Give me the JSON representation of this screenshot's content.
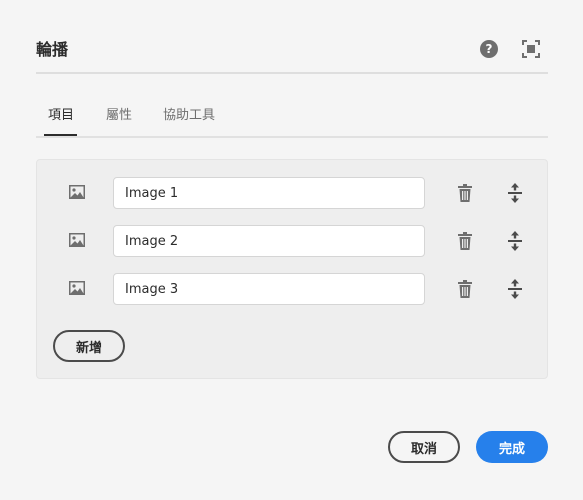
{
  "dialog": {
    "title": "輪播",
    "help_icon": "help-icon",
    "fullscreen_icon": "fullscreen-icon"
  },
  "tabs": [
    {
      "label": "項目",
      "active": true
    },
    {
      "label": "屬性",
      "active": false
    },
    {
      "label": "協助工具",
      "active": false
    }
  ],
  "items": [
    {
      "value": "Image 1",
      "icon": "image-icon"
    },
    {
      "value": "Image 2",
      "icon": "image-icon"
    },
    {
      "value": "Image 3",
      "icon": "image-icon"
    }
  ],
  "add_label": "新增",
  "footer": {
    "cancel_label": "取消",
    "done_label": "完成"
  },
  "colors": {
    "primary": "#2680eb",
    "background": "#f5f5f5",
    "panel": "#eeeeee"
  }
}
